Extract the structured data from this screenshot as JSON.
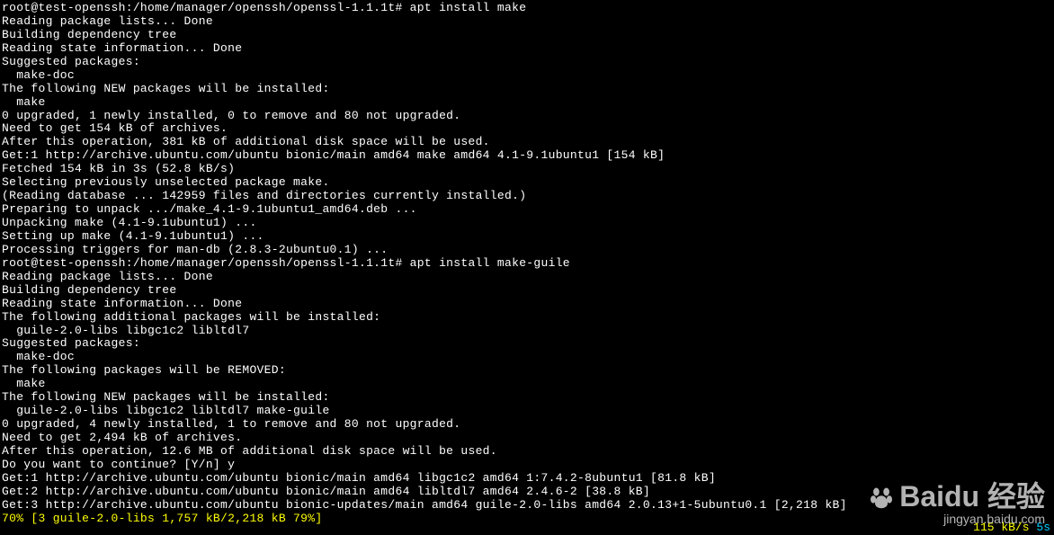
{
  "terminal": {
    "lines": [
      "root@test-openssh:/home/manager/openssh/openssl-1.1.1t# apt install make",
      "Reading package lists... Done",
      "Building dependency tree",
      "Reading state information... Done",
      "Suggested packages:",
      "  make-doc",
      "The following NEW packages will be installed:",
      "  make",
      "0 upgraded, 1 newly installed, 0 to remove and 80 not upgraded.",
      "Need to get 154 kB of archives.",
      "After this operation, 381 kB of additional disk space will be used.",
      "Get:1 http://archive.ubuntu.com/ubuntu bionic/main amd64 make amd64 4.1-9.1ubuntu1 [154 kB]",
      "Fetched 154 kB in 3s (52.8 kB/s)",
      "Selecting previously unselected package make.",
      "(Reading database ... 142959 files and directories currently installed.)",
      "Preparing to unpack .../make_4.1-9.1ubuntu1_amd64.deb ...",
      "Unpacking make (4.1-9.1ubuntu1) ...",
      "Setting up make (4.1-9.1ubuntu1) ...",
      "Processing triggers for man-db (2.8.3-2ubuntu0.1) ...",
      "root@test-openssh:/home/manager/openssh/openssl-1.1.1t# apt install make-guile",
      "Reading package lists... Done",
      "Building dependency tree",
      "Reading state information... Done",
      "The following additional packages will be installed:",
      "  guile-2.0-libs libgc1c2 libltdl7",
      "Suggested packages:",
      "  make-doc",
      "The following packages will be REMOVED:",
      "  make",
      "The following NEW packages will be installed:",
      "  guile-2.0-libs libgc1c2 libltdl7 make-guile",
      "0 upgraded, 4 newly installed, 1 to remove and 80 not upgraded.",
      "Need to get 2,494 kB of archives.",
      "After this operation, 12.6 MB of additional disk space will be used.",
      "Do you want to continue? [Y/n] y",
      "Get:1 http://archive.ubuntu.com/ubuntu bionic/main amd64 libgc1c2 amd64 1:7.4.2-8ubuntu1 [81.8 kB]",
      "Get:2 http://archive.ubuntu.com/ubuntu bionic/main amd64 libltdl7 amd64 2.4.6-2 [38.8 kB]",
      "Get:3 http://archive.ubuntu.com/ubuntu bionic-updates/main amd64 guile-2.0-libs amd64 2.0.13+1-5ubuntu0.1 [2,218 kB]"
    ],
    "progress_line": "70% [3 guile-2.0-libs 1,757 kB/2,218 kB 79%]",
    "speed": "115 kB/s",
    "eta": "5s"
  },
  "watermark": {
    "brand_prefix": "Bai",
    "brand_suffix": "du",
    "brand_cn": "经验",
    "url": "jingyan.baidu.com"
  }
}
